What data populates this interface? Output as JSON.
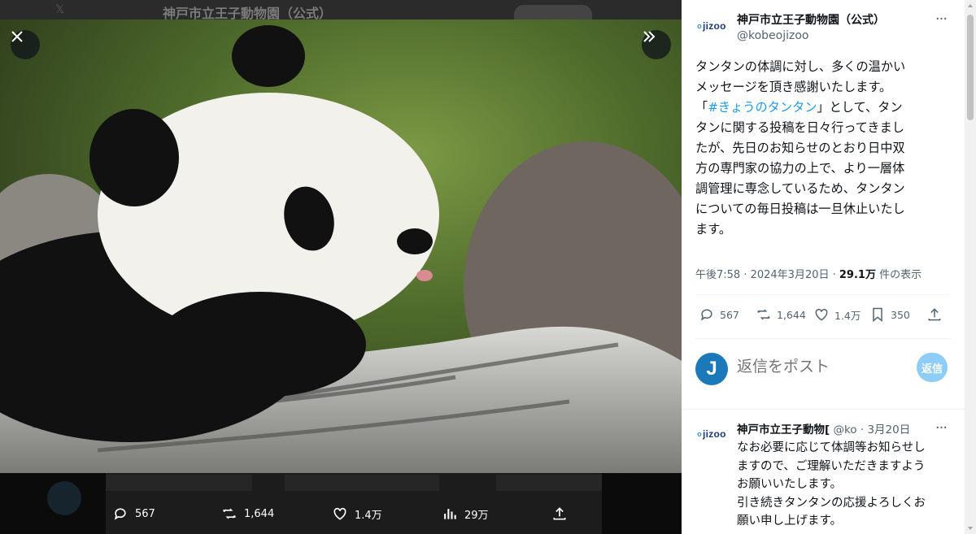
{
  "background": {
    "title": "神戸市立王子動物園（公式）"
  },
  "viewer": {
    "media_stats": {
      "replies": "567",
      "reposts": "1,644",
      "likes": "1.4万",
      "views": "29万"
    }
  },
  "post": {
    "account_name": "神戸市立王子動物園（公式）",
    "handle": "@kobeojizoo",
    "logo_text": "jizoo",
    "logo_mark": "o",
    "text_lines": [
      "タンタンの体調に対し、多くの温かい",
      "メッセージを頂き感謝いたします。",
      "「",
      "#きょうのタンタン",
      "」として、タン",
      "タンに関する投稿を日々行ってきまし",
      "たが、先日のお知らせのとおり日中双",
      "方の専門家の協力の上で、より一層体",
      "調管理に専念しているため、タンタン",
      "についての毎日投稿は一旦休止いたし",
      "ます。"
    ],
    "meta_time": "午後7:58 · 2024年3月20日 · ",
    "meta_views": "29.1万",
    "meta_views_label": " 件の表示",
    "stats": {
      "replies": "567",
      "reposts": "1,644",
      "likes": "1.4万",
      "bookmarks": "350"
    }
  },
  "reply_box": {
    "avatar_letter": "J",
    "placeholder": "返信をポスト",
    "button_label": "返信"
  },
  "reply_post": {
    "account_name": "神戸市立王子動物[",
    "handle": "@ko",
    "date": " · 3月20日",
    "text_lines": [
      "なお必要に応じて体調等お知らせし",
      "ますので、ご理解いただきますよう",
      "お願いいたします。",
      "引き続きタンタンの応援よろしくお",
      "願い申し上げます。"
    ]
  },
  "colors": {
    "accent": "#1d9bf0",
    "secondary_text": "#536471",
    "reply_button": "#8ecdf8",
    "avatar": "#1b79b9"
  }
}
